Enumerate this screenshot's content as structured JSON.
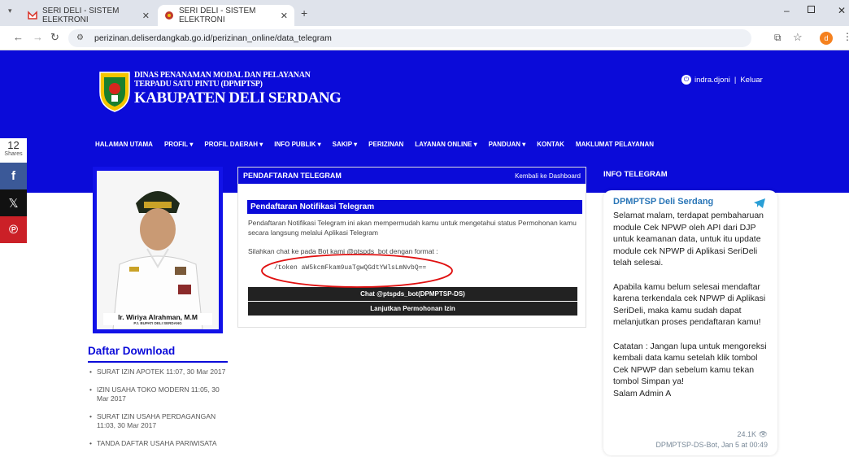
{
  "browser": {
    "tabs": [
      {
        "label": "SERI DELI - SISTEM ELEKTRONI"
      },
      {
        "label": "SERI DELI - SISTEM ELEKTRONI"
      }
    ],
    "url": "perizinan.deliserdangkab.go.id/perizinan_online/data_telegram",
    "profile_initial": "d"
  },
  "header": {
    "line1": "DINAS PENANAMAN MODAL DAN PELAYANAN",
    "line2": "TERPADU SATU PINTU (DPMPTSP)",
    "line3": "KABUPATEN DELI SERDANG",
    "user": "indra.djoni",
    "separator": "|",
    "logout": "Keluar"
  },
  "menu": [
    "HALAMAN UTAMA",
    "PROFIL ▾",
    "PROFIL DAERAH ▾",
    "INFO PUBLIK ▾",
    "SAKIP ▾",
    "PERIZINAN",
    "LAYANAN ONLINE ▾",
    "PANDUAN ▾",
    "KONTAK",
    "MAKLUMAT PELAYANAN"
  ],
  "share": {
    "count": "12",
    "label": "Shares"
  },
  "photo": {
    "name": "Ir. Wiriya Alrahman, M.M",
    "title": "PJ. BUPATI DELI SERDANG"
  },
  "panel": {
    "title": "PENDAFTARAN TELEGRAM",
    "back_link": "Kembali ke Dashboard",
    "subtitle": "Pendaftaran Notifikasi Telegram",
    "description": "Pendaftaran Notifikasi Telegram ini akan mempermudah kamu untuk mengetahui status Permohonan kamu secara langsung melalui Aplikasi Telegram",
    "instruction": "Silahkan chat ke pada Bot kami @ptspds_bot dengan format :",
    "token": "/token aW5kcmFkam9uaTgwQGdtYWlsLmNvbQ==",
    "btn_chat": "Chat @ptspds_bot(DPMPTSP-DS)",
    "btn_continue": "Lanjutkan Permohonan Izin"
  },
  "info": {
    "title": "INFO TELEGRAM",
    "channel": "DPMPTSP Deli Serdang",
    "message": "Selamat malam, terdapat pembaharuan module Cek NPWP oleh API dari DJP untuk keamanan data, untuk itu update module cek NPWP di Aplikasi SeriDeli telah selesai.\n\nApabila kamu belum selesai mendaftar karena terkendala cek NPWP di Aplikasi SeriDeli, maka kamu sudah dapat melanjutkan proses pendaftaran kamu!\n\nCatatan : Jangan lupa untuk mengoreksi kembali data kamu setelah klik tombol Cek NPWP dan sebelum kamu tekan tombol Simpan ya!\nSalam Admin A",
    "views": "24.1K",
    "meta": "DPMPTSP-DS-Bot, Jan 5 at 00:49"
  },
  "downloads": {
    "title": "Daftar Download",
    "items": [
      {
        "name": "SURAT IZIN APOTEK",
        "date": "11:07, 30 Mar 2017"
      },
      {
        "name": "IZIN USAHA TOKO MODERN",
        "date": "11:05, 30 Mar 2017"
      },
      {
        "name": "SURAT IZIN USAHA PERDAGANGAN",
        "date": "11:03, 30 Mar 2017"
      },
      {
        "name": "TANDA DAFTAR USAHA PARIWISATA",
        "date": ""
      }
    ]
  },
  "colors": {
    "brand_blue": "#0b0bd9",
    "telegram_blue": "#2a9fd6",
    "facebook": "#3b5998",
    "x": "#111111",
    "pinterest": "#cb2027",
    "annotation_red": "#e01010"
  }
}
